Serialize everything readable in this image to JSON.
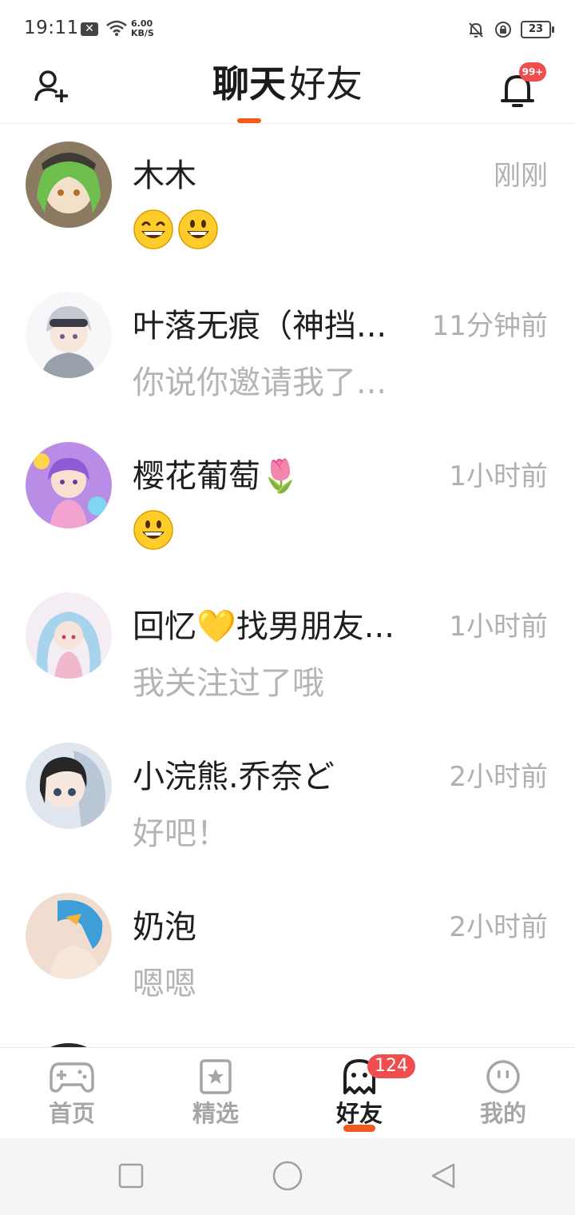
{
  "status_bar": {
    "time": "19:11",
    "x_icon": "✕",
    "net_speed_value": "6.00",
    "net_speed_unit": "KB/S",
    "battery": "23"
  },
  "header": {
    "tabs": [
      {
        "label": "聊天",
        "active": true
      },
      {
        "label": "好友",
        "active": false
      }
    ],
    "bell_badge": "99+"
  },
  "chats": [
    {
      "name": "木木",
      "time": "刚刚",
      "message": "",
      "emoji_count": 2,
      "avatar_colors": [
        "#7fbf6a",
        "#f3e0c9"
      ]
    },
    {
      "name": "叶落无痕（神挡...",
      "time": "11分钟前",
      "message": "你说你邀请我了...",
      "emoji_count": 0,
      "avatar_colors": [
        "#c9c9d2",
        "#f5f5f7"
      ]
    },
    {
      "name": "樱花葡萄🌷",
      "time": "1小时前",
      "message": "",
      "emoji_count": 1,
      "avatar_colors": [
        "#9c6fd6",
        "#f2a6d8"
      ]
    },
    {
      "name": "回忆💛找男朋友...",
      "time": "1小时前",
      "message": "我关注过了哦",
      "emoji_count": 0,
      "avatar_colors": [
        "#a9d6ec",
        "#f7e6f0"
      ]
    },
    {
      "name": "小浣熊.乔奈ど",
      "time": "2小时前",
      "message": "好吧！",
      "emoji_count": 0,
      "avatar_colors": [
        "#2b2b2b",
        "#c8d6e8"
      ]
    },
    {
      "name": "奶泡",
      "time": "2小时前",
      "message": "嗯嗯",
      "emoji_count": 0,
      "avatar_colors": [
        "#4aa3d9",
        "#f3ddcf"
      ]
    }
  ],
  "bottom_nav": {
    "items": [
      {
        "label": "首页",
        "icon": "gamepad-icon"
      },
      {
        "label": "精选",
        "icon": "star-book-icon"
      },
      {
        "label": "好友",
        "icon": "ghost-icon",
        "badge": "124",
        "active": true
      },
      {
        "label": "我的",
        "icon": "face-icon"
      }
    ]
  },
  "colors": {
    "accent": "#f25a1d",
    "badge": "#f04e4e",
    "muted_text": "#b0b0b0"
  }
}
